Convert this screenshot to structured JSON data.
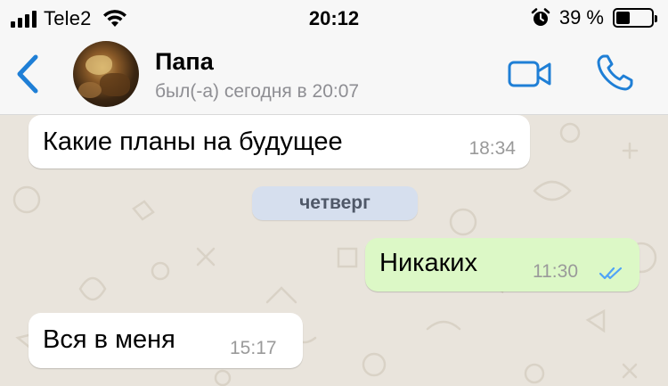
{
  "status_bar": {
    "carrier": "Tele2",
    "time": "20:12",
    "battery_percent": "39 %",
    "battery_level": 0.39,
    "icons": [
      "signal-icon",
      "wifi-icon",
      "alarm-icon",
      "battery-icon"
    ]
  },
  "header": {
    "back_icon": "chevron-left-icon",
    "name": "Папа",
    "last_seen": "был(-а) сегодня в 20:07",
    "video_icon": "video-camera-icon",
    "call_icon": "phone-icon",
    "accent_color": "#1f7fd6"
  },
  "chat": {
    "wallpaper_color": "#e9e4dc",
    "date_separator": "четверг",
    "messages": [
      {
        "direction": "incoming",
        "text": "Какие планы на будущее",
        "time": "18:34"
      },
      {
        "direction": "outgoing",
        "text": "Никаких",
        "time": "11:30",
        "status": "read",
        "status_icon": "double-check-icon"
      },
      {
        "direction": "incoming",
        "text": "Вся в меня",
        "time": "15:17"
      }
    ],
    "colors": {
      "incoming_bubble": "#ffffff",
      "outgoing_bubble": "#dcf8c6",
      "date_chip": "#d6dfee",
      "read_ticks": "#4fa3f7"
    }
  }
}
